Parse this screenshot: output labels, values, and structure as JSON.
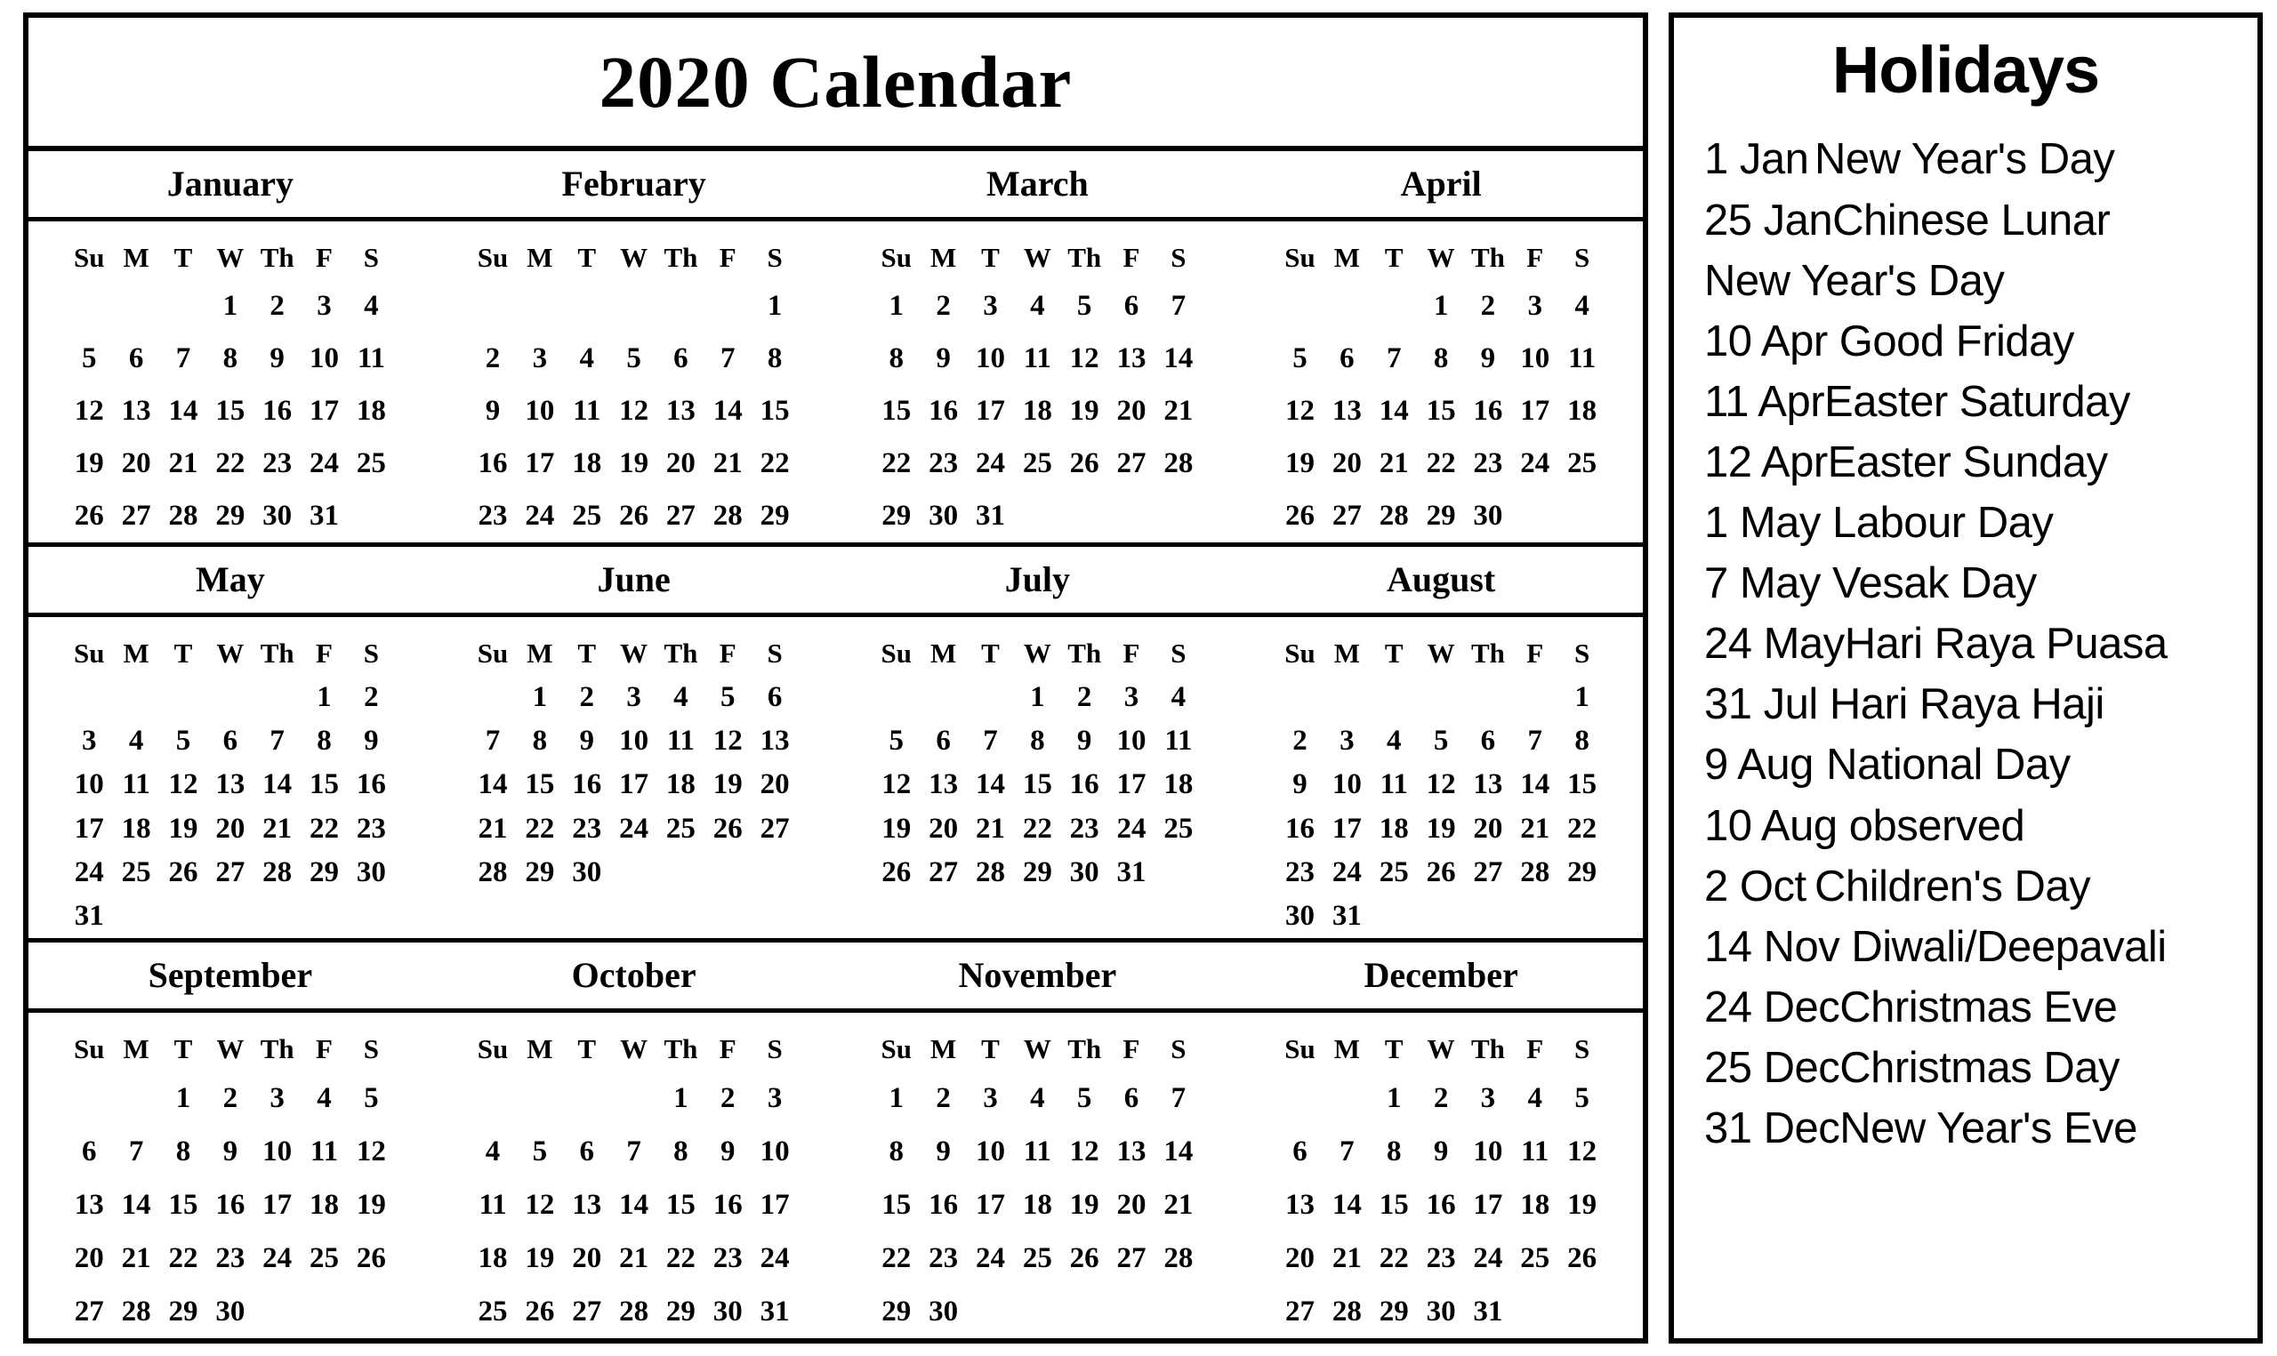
{
  "calendar": {
    "title": "2020 Calendar",
    "weekday_headers": [
      "Su",
      "M",
      "T",
      "W",
      "Th",
      "F",
      "S"
    ],
    "sunday_color": "#a8a8a8",
    "text_color": "#000000",
    "border_color": "#000000",
    "background": "#ffffff",
    "quarters": [
      {
        "months": [
          {
            "name": "January",
            "weeks": [
              [
                "",
                "",
                "",
                "1",
                "2",
                "3",
                "4"
              ],
              [
                "5",
                "6",
                "7",
                "8",
                "9",
                "10",
                "11"
              ],
              [
                "12",
                "13",
                "14",
                "15",
                "16",
                "17",
                "18"
              ],
              [
                "19",
                "20",
                "21",
                "22",
                "23",
                "24",
                "25"
              ],
              [
                "26",
                "27",
                "28",
                "29",
                "30",
                "31",
                ""
              ]
            ]
          },
          {
            "name": "February",
            "weeks": [
              [
                "",
                "",
                "",
                "",
                "",
                "",
                "1"
              ],
              [
                "2",
                "3",
                "4",
                "5",
                "6",
                "7",
                "8"
              ],
              [
                "9",
                "10",
                "11",
                "12",
                "13",
                "14",
                "15"
              ],
              [
                "16",
                "17",
                "18",
                "19",
                "20",
                "21",
                "22"
              ],
              [
                "23",
                "24",
                "25",
                "26",
                "27",
                "28",
                "29"
              ]
            ]
          },
          {
            "name": "March",
            "weeks": [
              [
                "1",
                "2",
                "3",
                "4",
                "5",
                "6",
                "7"
              ],
              [
                "8",
                "9",
                "10",
                "11",
                "12",
                "13",
                "14"
              ],
              [
                "15",
                "16",
                "17",
                "18",
                "19",
                "20",
                "21"
              ],
              [
                "22",
                "23",
                "24",
                "25",
                "26",
                "27",
                "28"
              ],
              [
                "29",
                "30",
                "31",
                "",
                "",
                "",
                ""
              ]
            ]
          },
          {
            "name": "April",
            "weeks": [
              [
                "",
                "",
                "",
                "1",
                "2",
                "3",
                "4"
              ],
              [
                "5",
                "6",
                "7",
                "8",
                "9",
                "10",
                "11"
              ],
              [
                "12",
                "13",
                "14",
                "15",
                "16",
                "17",
                "18"
              ],
              [
                "19",
                "20",
                "21",
                "22",
                "23",
                "24",
                "25"
              ],
              [
                "26",
                "27",
                "28",
                "29",
                "30",
                "",
                ""
              ]
            ]
          }
        ]
      },
      {
        "months": [
          {
            "name": "May",
            "weeks": [
              [
                "",
                "",
                "",
                "",
                "",
                "1",
                "2"
              ],
              [
                "3",
                "4",
                "5",
                "6",
                "7",
                "8",
                "9"
              ],
              [
                "10",
                "11",
                "12",
                "13",
                "14",
                "15",
                "16"
              ],
              [
                "17",
                "18",
                "19",
                "20",
                "21",
                "22",
                "23"
              ],
              [
                "24",
                "25",
                "26",
                "27",
                "28",
                "29",
                "30"
              ],
              [
                "31",
                "",
                "",
                "",
                "",
                "",
                ""
              ]
            ]
          },
          {
            "name": "June",
            "weeks": [
              [
                "",
                "1",
                "2",
                "3",
                "4",
                "5",
                "6"
              ],
              [
                "7",
                "8",
                "9",
                "10",
                "11",
                "12",
                "13"
              ],
              [
                "14",
                "15",
                "16",
                "17",
                "18",
                "19",
                "20"
              ],
              [
                "21",
                "22",
                "23",
                "24",
                "25",
                "26",
                "27"
              ],
              [
                "28",
                "29",
                "30",
                "",
                "",
                "",
                ""
              ],
              [
                "",
                "",
                "",
                "",
                "",
                "",
                ""
              ]
            ]
          },
          {
            "name": "July",
            "weeks": [
              [
                "",
                "",
                "",
                "1",
                "2",
                "3",
                "4"
              ],
              [
                "5",
                "6",
                "7",
                "8",
                "9",
                "10",
                "11"
              ],
              [
                "12",
                "13",
                "14",
                "15",
                "16",
                "17",
                "18"
              ],
              [
                "19",
                "20",
                "21",
                "22",
                "23",
                "24",
                "25"
              ],
              [
                "26",
                "27",
                "28",
                "29",
                "30",
                "31",
                ""
              ],
              [
                "",
                "",
                "",
                "",
                "",
                "",
                ""
              ]
            ]
          },
          {
            "name": "August",
            "weeks": [
              [
                "",
                "",
                "",
                "",
                "",
                "",
                "1"
              ],
              [
                "2",
                "3",
                "4",
                "5",
                "6",
                "7",
                "8"
              ],
              [
                "9",
                "10",
                "11",
                "12",
                "13",
                "14",
                "15"
              ],
              [
                "16",
                "17",
                "18",
                "19",
                "20",
                "21",
                "22"
              ],
              [
                "23",
                "24",
                "25",
                "26",
                "27",
                "28",
                "29"
              ],
              [
                "30",
                "31",
                "",
                "",
                "",
                "",
                ""
              ]
            ]
          }
        ]
      },
      {
        "months": [
          {
            "name": "September",
            "weeks": [
              [
                "",
                "",
                "1",
                "2",
                "3",
                "4",
                "5"
              ],
              [
                "6",
                "7",
                "8",
                "9",
                "10",
                "11",
                "12"
              ],
              [
                "13",
                "14",
                "15",
                "16",
                "17",
                "18",
                "19"
              ],
              [
                "20",
                "21",
                "22",
                "23",
                "24",
                "25",
                "26"
              ],
              [
                "27",
                "28",
                "29",
                "30",
                "",
                "",
                ""
              ]
            ]
          },
          {
            "name": "October",
            "weeks": [
              [
                "",
                "",
                "",
                "",
                "1",
                "2",
                "3"
              ],
              [
                "4",
                "5",
                "6",
                "7",
                "8",
                "9",
                "10"
              ],
              [
                "11",
                "12",
                "13",
                "14",
                "15",
                "16",
                "17"
              ],
              [
                "18",
                "19",
                "20",
                "21",
                "22",
                "23",
                "24"
              ],
              [
                "25",
                "26",
                "27",
                "28",
                "29",
                "30",
                "31"
              ]
            ]
          },
          {
            "name": "November",
            "weeks": [
              [
                "1",
                "2",
                "3",
                "4",
                "5",
                "6",
                "7"
              ],
              [
                "8",
                "9",
                "10",
                "11",
                "12",
                "13",
                "14"
              ],
              [
                "15",
                "16",
                "17",
                "18",
                "19",
                "20",
                "21"
              ],
              [
                "22",
                "23",
                "24",
                "25",
                "26",
                "27",
                "28"
              ],
              [
                "29",
                "30",
                "",
                "",
                "",
                "",
                ""
              ]
            ]
          },
          {
            "name": "December",
            "weeks": [
              [
                "",
                "",
                "1",
                "2",
                "3",
                "4",
                "5"
              ],
              [
                "6",
                "7",
                "8",
                "9",
                "10",
                "11",
                "12"
              ],
              [
                "13",
                "14",
                "15",
                "16",
                "17",
                "18",
                "19"
              ],
              [
                "20",
                "21",
                "22",
                "23",
                "24",
                "25",
                "26"
              ],
              [
                "27",
                "28",
                "29",
                "30",
                "31",
                "",
                ""
              ]
            ]
          }
        ]
      }
    ]
  },
  "holidays": {
    "title": "Holidays",
    "items": [
      {
        "date": "1 Jan",
        "name": "New Year's Day",
        "continuation": false
      },
      {
        "date": "25 Jan",
        "name": "Chinese Lunar",
        "continuation": false
      },
      {
        "date": "",
        "name": "New Year's Day",
        "continuation": true
      },
      {
        "date": "10 Apr",
        "name": " Good Friday",
        "continuation": false
      },
      {
        "date": "11 Apr",
        "name": "Easter Saturday",
        "continuation": false
      },
      {
        "date": "12 Apr",
        "name": "Easter Sunday",
        "continuation": false
      },
      {
        "date": "1 May",
        "name": "  Labour Day",
        "continuation": false
      },
      {
        "date": "7 May",
        "name": "  Vesak Day",
        "continuation": false
      },
      {
        "date": "24 May",
        "name": "Hari Raya Puasa",
        "continuation": false
      },
      {
        "date": "31 Jul",
        "name": "  Hari Raya Haji",
        "continuation": false
      },
      {
        "date": "9 Aug",
        "name": "  National Day",
        "continuation": false
      },
      {
        "date": "10 Aug",
        "name": " observed",
        "continuation": false
      },
      {
        "date": "2 Oct",
        "name": "Children's Day",
        "continuation": false
      },
      {
        "date": "14 Nov",
        "name": " Diwali/Deepavali",
        "continuation": false
      },
      {
        "date": "24 Dec",
        "name": "Christmas Eve",
        "continuation": false
      },
      {
        "date": "25 Dec",
        "name": "Christmas Day",
        "continuation": false
      },
      {
        "date": "31 Dec",
        "name": "New Year's Eve",
        "continuation": false
      }
    ]
  }
}
